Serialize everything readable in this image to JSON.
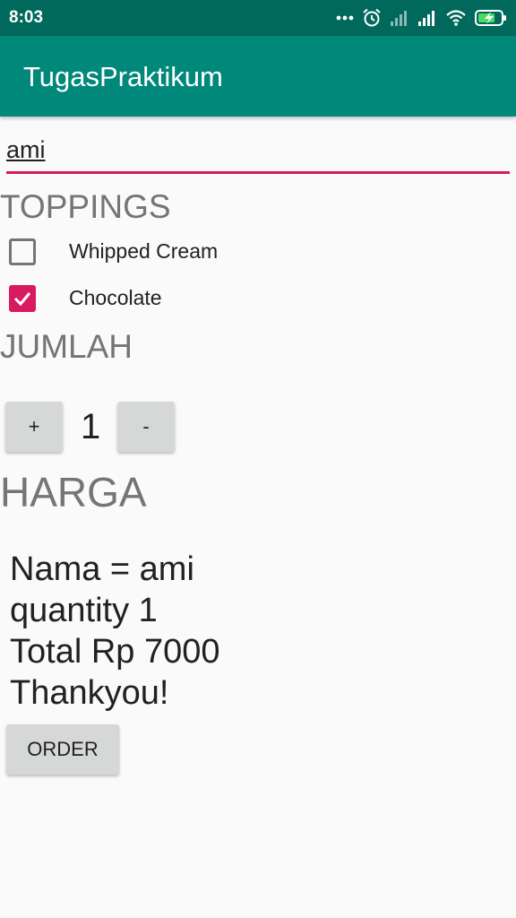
{
  "status_bar": {
    "time": "8:03",
    "icons": [
      "more-dots-icon",
      "alarm-icon",
      "signal-off-icon",
      "signal-icon",
      "wifi-icon",
      "battery-charging-icon"
    ]
  },
  "app_bar": {
    "title": "TugasPraktikum"
  },
  "name_input": {
    "value": "ami"
  },
  "toppings": {
    "header": "TOPPINGS",
    "items": [
      {
        "label": "Whipped Cream",
        "checked": false
      },
      {
        "label": "Chocolate",
        "checked": true
      }
    ]
  },
  "quantity": {
    "header": "JUMLAH",
    "plus_label": "+",
    "minus_label": "-",
    "value": "1"
  },
  "price": {
    "header": "HARGA"
  },
  "summary": {
    "line1": "Nama = ami",
    "line2": "quantity 1",
    "line3": "Total Rp 7000",
    "line4": "Thankyou!"
  },
  "order_button": {
    "label": "ORDER"
  },
  "colors": {
    "status_bar": "#00695c",
    "app_bar": "#00897b",
    "accent": "#d81b60"
  }
}
